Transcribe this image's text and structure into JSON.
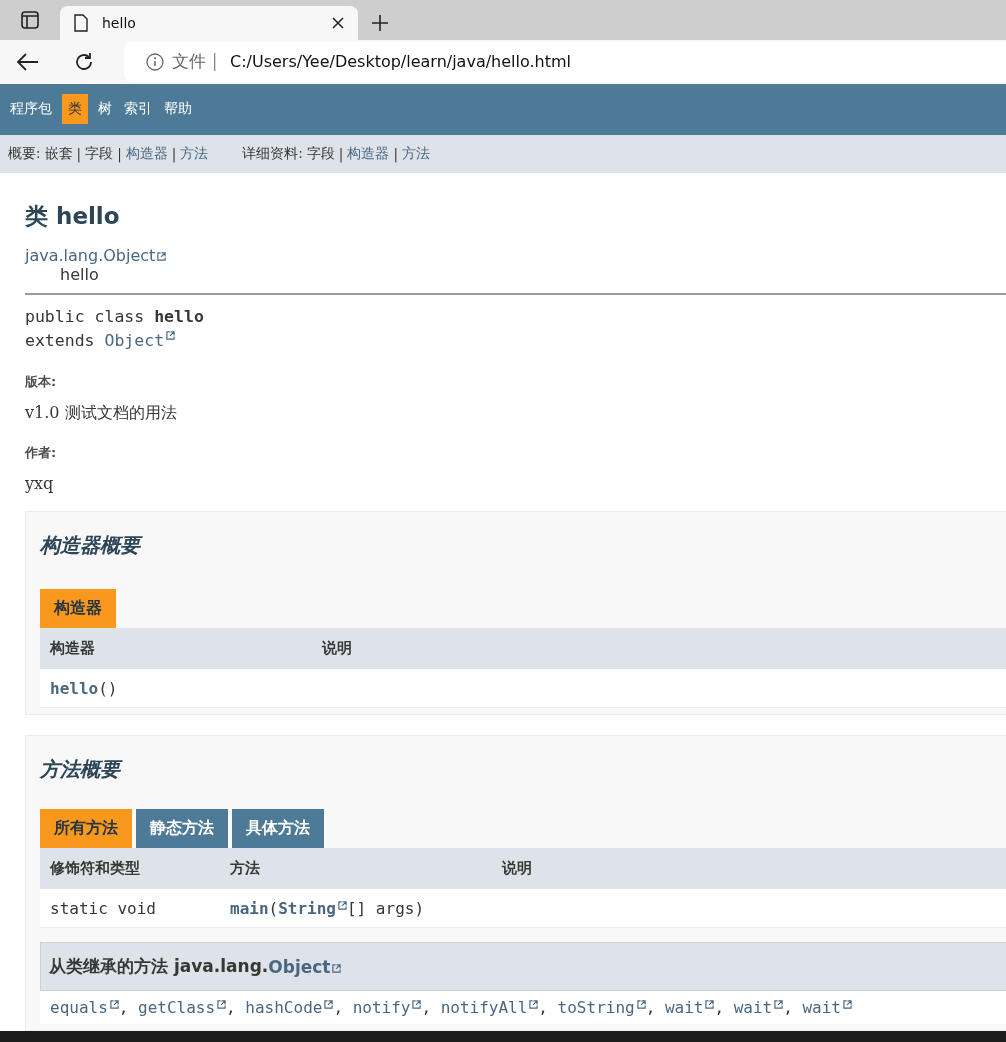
{
  "browser": {
    "tab_title": "hello",
    "address_label": "文件",
    "url": "C:/Users/Yee/Desktop/learn/java/hello.html"
  },
  "nav": {
    "items": [
      {
        "label": "程序包",
        "selected": false
      },
      {
        "label": "类",
        "selected": true
      },
      {
        "label": "树",
        "selected": false
      },
      {
        "label": "索引",
        "selected": false
      },
      {
        "label": "帮助",
        "selected": false
      }
    ]
  },
  "subnav": {
    "groups": [
      {
        "label": "概要:",
        "separator": "|",
        "items": [
          {
            "label": "嵌套",
            "link": false
          },
          {
            "label": "字段",
            "link": false
          },
          {
            "label": "构造器",
            "link": true
          },
          {
            "label": "方法",
            "link": true
          }
        ]
      },
      {
        "label": "详细资料:",
        "separator": "|",
        "items": [
          {
            "label": "字段",
            "link": false
          },
          {
            "label": "构造器",
            "link": true
          },
          {
            "label": "方法",
            "link": true
          }
        ]
      }
    ]
  },
  "header": {
    "title": "类 hello",
    "inheritance": [
      {
        "label": "java.lang.Object",
        "link": true
      },
      {
        "label": "hello",
        "link": false
      }
    ]
  },
  "signature": {
    "lines": [
      [
        {
          "text": "public class ",
          "kind": "plain"
        },
        {
          "text": "hello",
          "kind": "bold"
        }
      ],
      [
        {
          "text": "extends ",
          "kind": "plain"
        },
        {
          "text": "Object",
          "kind": "external"
        }
      ]
    ]
  },
  "notes": [
    {
      "label": "版本:",
      "value": "v1.0 测试文档的用法"
    },
    {
      "label": "作者:",
      "value": "yxq"
    }
  ],
  "constructor_summary": {
    "title": "构造器概要",
    "tabs": [
      {
        "label": "构造器",
        "selected": true
      }
    ],
    "columns": [
      "构造器",
      "说明"
    ],
    "rows": [
      {
        "cells": [
          [
            {
              "text": "hello",
              "kind": "bold-link"
            },
            {
              "text": "()",
              "kind": "plain"
            }
          ],
          []
        ]
      }
    ]
  },
  "method_summary": {
    "title": "方法概要",
    "tabs": [
      {
        "label": "所有方法",
        "selected": true
      },
      {
        "label": "静态方法",
        "selected": false
      },
      {
        "label": "具体方法",
        "selected": false
      }
    ],
    "columns": [
      "修饰符和类型",
      "方法",
      "说明"
    ],
    "rows": [
      {
        "cells": [
          [
            {
              "text": "static void",
              "kind": "plain"
            }
          ],
          [
            {
              "text": "main",
              "kind": "bold-link"
            },
            {
              "text": "(",
              "kind": "plain"
            },
            {
              "text": "String",
              "kind": "bold-external"
            },
            {
              "text": "[] args)",
              "kind": "plain"
            }
          ],
          []
        ]
      }
    ]
  },
  "inherited": {
    "title": "从类继承的方法 java.lang.",
    "class_link": "Object",
    "separator": ",",
    "methods": [
      "equals",
      "getClass",
      "hashCode",
      "notify",
      "notifyAll",
      "toString",
      "wait",
      "wait",
      "wait"
    ]
  }
}
